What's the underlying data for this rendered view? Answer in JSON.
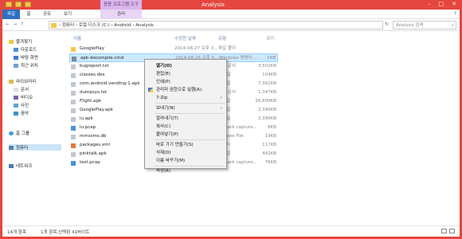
{
  "window": {
    "title": "Analysis",
    "minimize": "–",
    "maximize": "□",
    "close": "✕"
  },
  "ribbon": {
    "contextual_title": "응용 프로그램 도구",
    "tabs": [
      {
        "label": "파일"
      },
      {
        "label": "홈"
      },
      {
        "label": "공유"
      },
      {
        "label": "보기"
      },
      {
        "label": "관리"
      }
    ],
    "help": "?"
  },
  "address": {
    "back": "←",
    "forward": "→",
    "up": "↑",
    "path": "› 컴퓨터 › 로컬 디스크 (C:) › Android › Analysis",
    "refresh": "↻",
    "search_placeholder": "Analysis 검색",
    "search_icon": "⌕"
  },
  "nav": {
    "favorites": "즐겨찾기",
    "downloads": "다운로드",
    "desktop": "바탕 화면",
    "recent": "최근 위치",
    "libraries": "라이브러리",
    "documents": "문서",
    "videos": "비디오",
    "pictures": "사진",
    "music": "음악",
    "homegroup": "홈 그룹",
    "computer": "컴퓨터",
    "network": "네트워크"
  },
  "columns": {
    "name": "이름",
    "date": "수정한 날짜",
    "type": "유형",
    "size": "크기"
  },
  "files": [
    {
      "name": "GooglePlay",
      "date": "2014-08-27 오후 3...",
      "type": "파일 폴더",
      "size": "",
      "color": "#f2c84b"
    },
    {
      "name": "apk-decompile.cmd",
      "date": "2014-08-26 오후 5...",
      "type": "Windows 명령어 ...",
      "size": "1KB",
      "color": "#7a8a99"
    },
    {
      "name": "bugreport.txt",
      "date": "",
      "type": "스트 문서",
      "size": "3,502KB",
      "color": "#bfc8d2"
    },
    {
      "name": "classes.dex",
      "date": "",
      "type": "X 파일",
      "size": "104KB",
      "color": "#bfc8d2"
    },
    {
      "name": "com.android.vending-1.apk",
      "date": "",
      "type": "K 파일",
      "size": "7,362KB",
      "color": "#bfc8d2"
    },
    {
      "name": "dumpsys.txt",
      "date": "",
      "type": "스트 문서",
      "size": "1,347KB",
      "color": "#bfc8d2"
    },
    {
      "name": "Flight.apk",
      "date": "",
      "type": "K 파일",
      "size": "26,809KB",
      "color": "#bfc8d2"
    },
    {
      "name": "GooglePlay.apk",
      "date": "",
      "type": "K 파일",
      "size": "2,396KB",
      "color": "#bfc8d2"
    },
    {
      "name": "lu.apk",
      "date": "",
      "type": "K 파일",
      "size": "2,396KB",
      "color": "#bfc8d2"
    },
    {
      "name": "lu.pcap",
      "date": "",
      "type": "reshark capture...",
      "size": "8KB",
      "color": "#4a90d9"
    },
    {
      "name": "mmssms.db",
      "date": "",
      "type": "ta Base File",
      "size": "19KB",
      "color": "#bfc8d2"
    },
    {
      "name": "packages.xml",
      "date": "",
      "type": "L 문서",
      "size": "117KB",
      "color": "#e07b39"
    },
    {
      "name": "pinktalk.apk",
      "date": "",
      "type": "K 파일",
      "size": "442KB",
      "color": "#bfc8d2"
    },
    {
      "name": "test.pcap",
      "date": "",
      "type": "reshark capture...",
      "size": "76KB",
      "color": "#4a90d9"
    }
  ],
  "context_menu": [
    {
      "label": "열기(O)",
      "bold": true
    },
    {
      "label": "편집(E)"
    },
    {
      "label": "인쇄(P)"
    },
    {
      "label": "관리자 권한으로 실행(A)",
      "icon": true
    },
    {
      "label": "7-Zip",
      "submenu": true
    },
    {
      "sep": true
    },
    {
      "label": "보내기(N)",
      "submenu": true
    },
    {
      "sep": true
    },
    {
      "label": "잘라내기(T)"
    },
    {
      "label": "복사(C)"
    },
    {
      "label": "붙여넣기(P)"
    },
    {
      "sep": true
    },
    {
      "label": "바로 가기 만들기(S)"
    },
    {
      "label": "삭제(D)"
    },
    {
      "label": "이름 바꾸기(M)"
    },
    {
      "sep": true
    },
    {
      "label": "속성(R)"
    }
  ],
  "status": {
    "items": "14개 항목",
    "selected": "1개 항목 선택함 41바이트"
  }
}
